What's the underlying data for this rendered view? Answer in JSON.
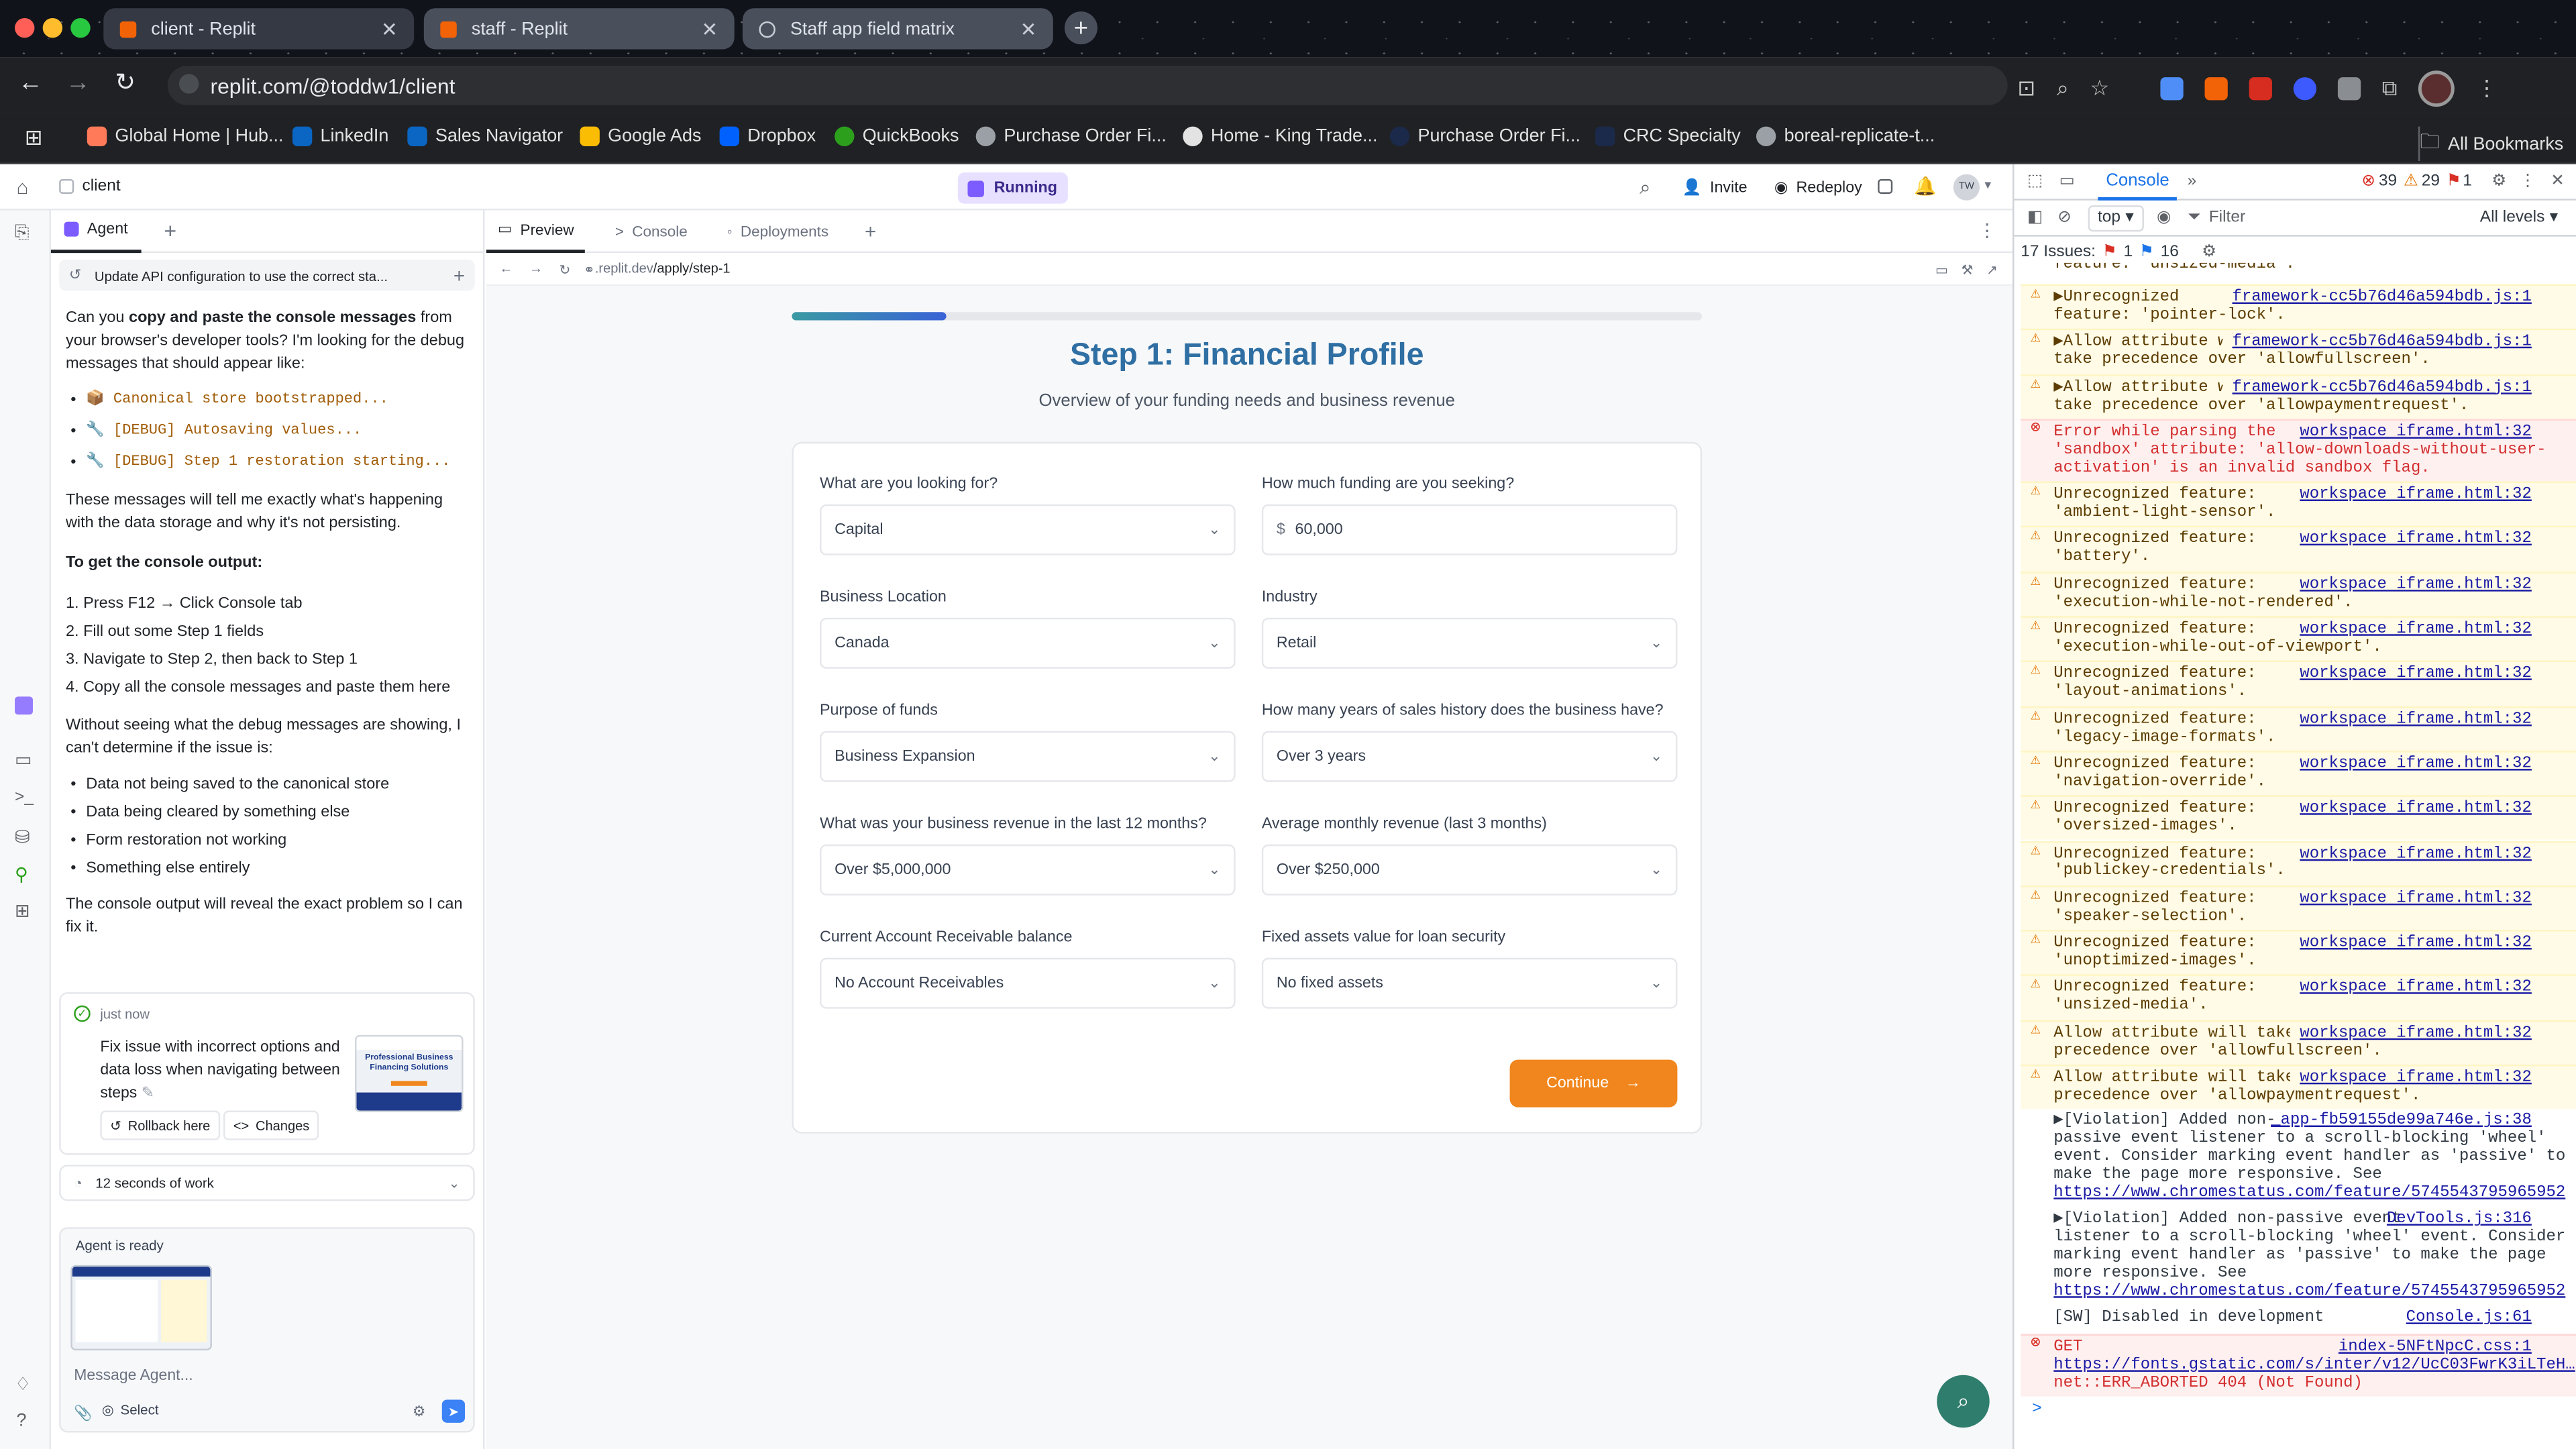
{
  "browser": {
    "tabs": [
      {
        "title": "client - Replit"
      },
      {
        "title": "staff - Replit"
      },
      {
        "title": "Staff app field matrix"
      }
    ],
    "url": "replit.com/@toddw1/client",
    "bookmarks": [
      "Global Home | Hub...",
      "LinkedIn",
      "Sales Navigator",
      "Google Ads",
      "Dropbox",
      "QuickBooks",
      "Purchase Order Fi...",
      "Home - King Trade...",
      "Purchase Order Fi...",
      "CRC Specialty",
      "boreal-replicate-t..."
    ],
    "all_bookmarks": "All Bookmarks",
    "avatar_initials": "TW"
  },
  "replit": {
    "project": "client",
    "status": "Running",
    "invite": "Invite",
    "redeploy": "Redeploy",
    "user_initials": "TW",
    "agent_tab": "Agent",
    "preview_tabs": [
      "Preview",
      "Console",
      "Deployments"
    ],
    "preview_url_prefix": ".replit.dev",
    "preview_url_path": "/apply/step-1"
  },
  "agent": {
    "thread_title": "Update API configuration to use the correct sta...",
    "intro_a": "Can you ",
    "intro_b": "copy and paste the console messages",
    "intro_c": " from your browser's developer tools? I'm looking for the debug messages that should appear like:",
    "code_items": [
      "📦 Canonical store bootstrapped...",
      "🔧 [DEBUG] Autosaving values...",
      "🔧 [DEBUG] Step 1 restoration starting..."
    ],
    "p2": "These messages will tell me exactly what's happening with the data storage and why it's not persisting.",
    "heading": "To get the console output:",
    "steps": [
      "1. Press F12 → Click Console tab",
      "2. Fill out some Step 1 fields",
      "3. Navigate to Step 2, then back to Step 1",
      "4. Copy all the console messages and paste them here"
    ],
    "p3": "Without seeing what the debug messages are showing, I can't determine if the issue is:",
    "issues": [
      "Data not being saved to the canonical store",
      "Data being cleared by something else",
      "Form restoration not working",
      "Something else entirely"
    ],
    "p4": "The console output will reveal the exact problem so I can fix it.",
    "checkpoint_time": "just now",
    "checkpoint_text": "Fix issue with incorrect options and data loss when navigating between steps",
    "rollback": "Rollback here",
    "changes": "Changes",
    "thumb_text": "Professional Business Financing Solutions",
    "work_summary": "12 seconds of work",
    "ready": "Agent is ready",
    "input_placeholder": "Message Agent...",
    "select_label": "Select"
  },
  "form": {
    "progress": 0.17,
    "title": "Step 1: Financial Profile",
    "subtitle": "Overview of your funding needs and business revenue",
    "fields": [
      {
        "label": "What are you looking for?",
        "value": "Capital"
      },
      {
        "label": "How much funding are you seeking?",
        "value": "60,000",
        "prefix": "$"
      },
      {
        "label": "Business Location",
        "value": "Canada"
      },
      {
        "label": "Industry",
        "value": "Retail"
      },
      {
        "label": "Purpose of funds",
        "value": "Business Expansion"
      },
      {
        "label": "How many years of sales history does the business have?",
        "value": "Over 3 years"
      },
      {
        "label": "What was your business revenue in the last 12 months?",
        "value": "Over $5,000,000"
      },
      {
        "label": "Average monthly revenue (last 3 months)",
        "value": "Over $250,000"
      },
      {
        "label": "Current Account Receivable balance",
        "value": "No Account Receivables"
      },
      {
        "label": "Fixed assets value for loan security",
        "value": "No fixed assets"
      }
    ],
    "continue": "Continue"
  },
  "devtools": {
    "tab": "Console",
    "errors": "39",
    "warnings": "29",
    "issues_count": "1",
    "context": "top",
    "filter_placeholder": "Filter",
    "levels": "All levels",
    "issues_label": "17 Issues:",
    "issue_err": "1",
    "issue_info": "16",
    "top_clip": "feature: 'unsized-media'.",
    "messages": [
      {
        "kind": "warn",
        "lines": [
          "▶Unrecognized",
          "feature: 'pointer-lock'."
        ],
        "src": "framework-cc5b76d46a594bdb.js:1"
      },
      {
        "kind": "warn",
        "lines": [
          "▶Allow attribute will",
          "take precedence over 'allowfullscreen'."
        ],
        "src": "framework-cc5b76d46a594bdb.js:1"
      },
      {
        "kind": "warn",
        "lines": [
          "▶Allow attribute will",
          "take precedence over 'allowpaymentrequest'."
        ],
        "src": "framework-cc5b76d46a594bdb.js:1"
      },
      {
        "kind": "err",
        "lines": [
          "Error while parsing the",
          "'sandbox' attribute: 'allow-downloads-without-user-",
          "activation' is an invalid sandbox flag."
        ],
        "src": "workspace iframe.html:32"
      },
      {
        "kind": "warn",
        "lines": [
          "Unrecognized feature:",
          "'ambient-light-sensor'."
        ],
        "src": "workspace iframe.html:32"
      },
      {
        "kind": "warn",
        "lines": [
          "Unrecognized feature:",
          "'battery'."
        ],
        "src": "workspace iframe.html:32"
      },
      {
        "kind": "warn",
        "lines": [
          "Unrecognized feature:",
          "'execution-while-not-rendered'."
        ],
        "src": "workspace iframe.html:32"
      },
      {
        "kind": "warn",
        "lines": [
          "Unrecognized feature:",
          "'execution-while-out-of-viewport'."
        ],
        "src": "workspace iframe.html:32"
      },
      {
        "kind": "warn",
        "lines": [
          "Unrecognized feature:",
          "'layout-animations'."
        ],
        "src": "workspace iframe.html:32"
      },
      {
        "kind": "warn",
        "lines": [
          "Unrecognized feature:",
          "'legacy-image-formats'."
        ],
        "src": "workspace iframe.html:32"
      },
      {
        "kind": "warn",
        "lines": [
          "Unrecognized feature:",
          "'navigation-override'."
        ],
        "src": "workspace iframe.html:32"
      },
      {
        "kind": "warn",
        "lines": [
          "Unrecognized feature:",
          "'oversized-images'."
        ],
        "src": "workspace iframe.html:32"
      },
      {
        "kind": "warn",
        "lines": [
          "Unrecognized feature:",
          "'publickey-credentials'."
        ],
        "src": "workspace iframe.html:32"
      },
      {
        "kind": "warn",
        "lines": [
          "Unrecognized feature:",
          "'speaker-selection'."
        ],
        "src": "workspace iframe.html:32"
      },
      {
        "kind": "warn",
        "lines": [
          "Unrecognized feature:",
          "'unoptimized-images'."
        ],
        "src": "workspace iframe.html:32"
      },
      {
        "kind": "warn",
        "lines": [
          "Unrecognized feature:",
          "'unsized-media'."
        ],
        "src": "workspace iframe.html:32"
      },
      {
        "kind": "warn",
        "lines": [
          "Allow attribute will take",
          "precedence over 'allowfullscreen'."
        ],
        "src": "workspace iframe.html:32"
      },
      {
        "kind": "warn",
        "lines": [
          "Allow attribute will take",
          "precedence over 'allowpaymentrequest'."
        ],
        "src": "workspace iframe.html:32"
      },
      {
        "kind": "plain",
        "lines": [
          "▶[Violation] Added non-",
          "passive event listener to a scroll-blocking 'wheel'",
          "event. Consider marking event handler as 'passive' to",
          "make the page more responsive. See",
          "https://www.chromestatus.com/feature/5745543795965952"
        ],
        "src": "_app-fb59155de99a746e.js:38"
      },
      {
        "kind": "plain",
        "lines": [
          "▶[Violation] Added non-passive event",
          "listener to a scroll-blocking 'wheel' event. Consider",
          "marking event handler as 'passive' to make the page",
          "more responsive. See",
          "https://www.chromestatus.com/feature/5745543795965952"
        ],
        "src": "DevTools.js:316"
      },
      {
        "kind": "plain",
        "lines": [
          "[SW] Disabled in development"
        ],
        "src": "Console.js:61"
      },
      {
        "kind": "err",
        "lines": [
          "GET",
          "https://fonts.gstatic.com/s/inter/v12/UcC03FwrK3iLTeH…",
          "net::ERR_ABORTED 404 (Not Found)"
        ],
        "src": "index-5NFtNpcC.css:1"
      }
    ],
    "prompt": ">"
  },
  "colors": {
    "accent_orange": "#f0861d",
    "title_blue": "#2f6fa3",
    "running_purple": "#7c5cff"
  }
}
